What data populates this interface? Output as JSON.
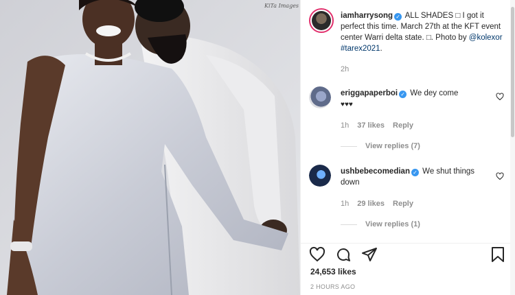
{
  "photo": {
    "watermark": "KiTa Images"
  },
  "post": {
    "author": "iamharrysong",
    "caption": "ALL SHADES □ I got it perfect this time. March 27th at the KFT event center Warri delta state. □. Photo by",
    "caption_mention": "@kolexor",
    "caption_hashtag": "#tarex2021",
    "caption_end": ".",
    "age": "2h"
  },
  "comments": [
    {
      "user": "eriggapaperboi",
      "text": "We dey come",
      "emoji": "♥♥♥",
      "time": "1h",
      "likes": "37 likes",
      "reply": "Reply",
      "view_replies": "View replies (7)"
    },
    {
      "user": "ushbebecomedian",
      "text": "We shut things down",
      "time": "1h",
      "likes": "29 likes",
      "reply": "Reply",
      "view_replies": "View replies (1)"
    }
  ],
  "footer": {
    "likes": "24,653 likes",
    "timestamp": "2 HOURS AGO"
  },
  "icons": {
    "like": "heart-outline-icon",
    "comment": "comment-bubble-icon",
    "share": "paper-plane-icon",
    "save": "bookmark-icon"
  },
  "colors": {
    "verified": "#3897f0",
    "link": "#00376b",
    "muted": "#8e8e8e"
  }
}
